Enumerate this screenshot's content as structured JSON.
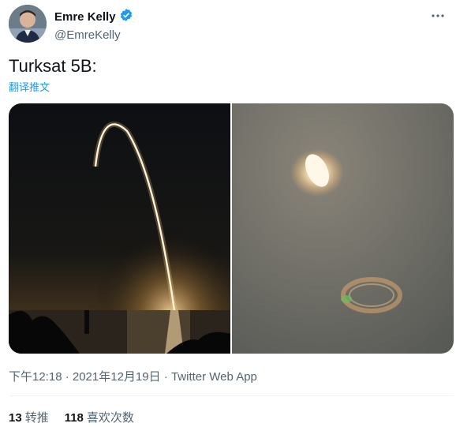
{
  "author": {
    "display_name": "Emre Kelly",
    "handle": "@EmreKelly",
    "verified": true
  },
  "tweet": {
    "text": "Turksat 5B:",
    "translate_label": "翻译推文",
    "timestamp": "下午12:18 · 2021年12月19日",
    "source": "Twitter Web App"
  },
  "stats": {
    "retweets_count": "13",
    "retweets_label": "转推",
    "likes_count": "118",
    "likes_label": "喜欢次数"
  },
  "icons": {
    "verified": "verified-badge-icon",
    "more": "more-options-icon"
  },
  "colors": {
    "accent": "#1d9bf0",
    "secondary_text": "#536471"
  }
}
